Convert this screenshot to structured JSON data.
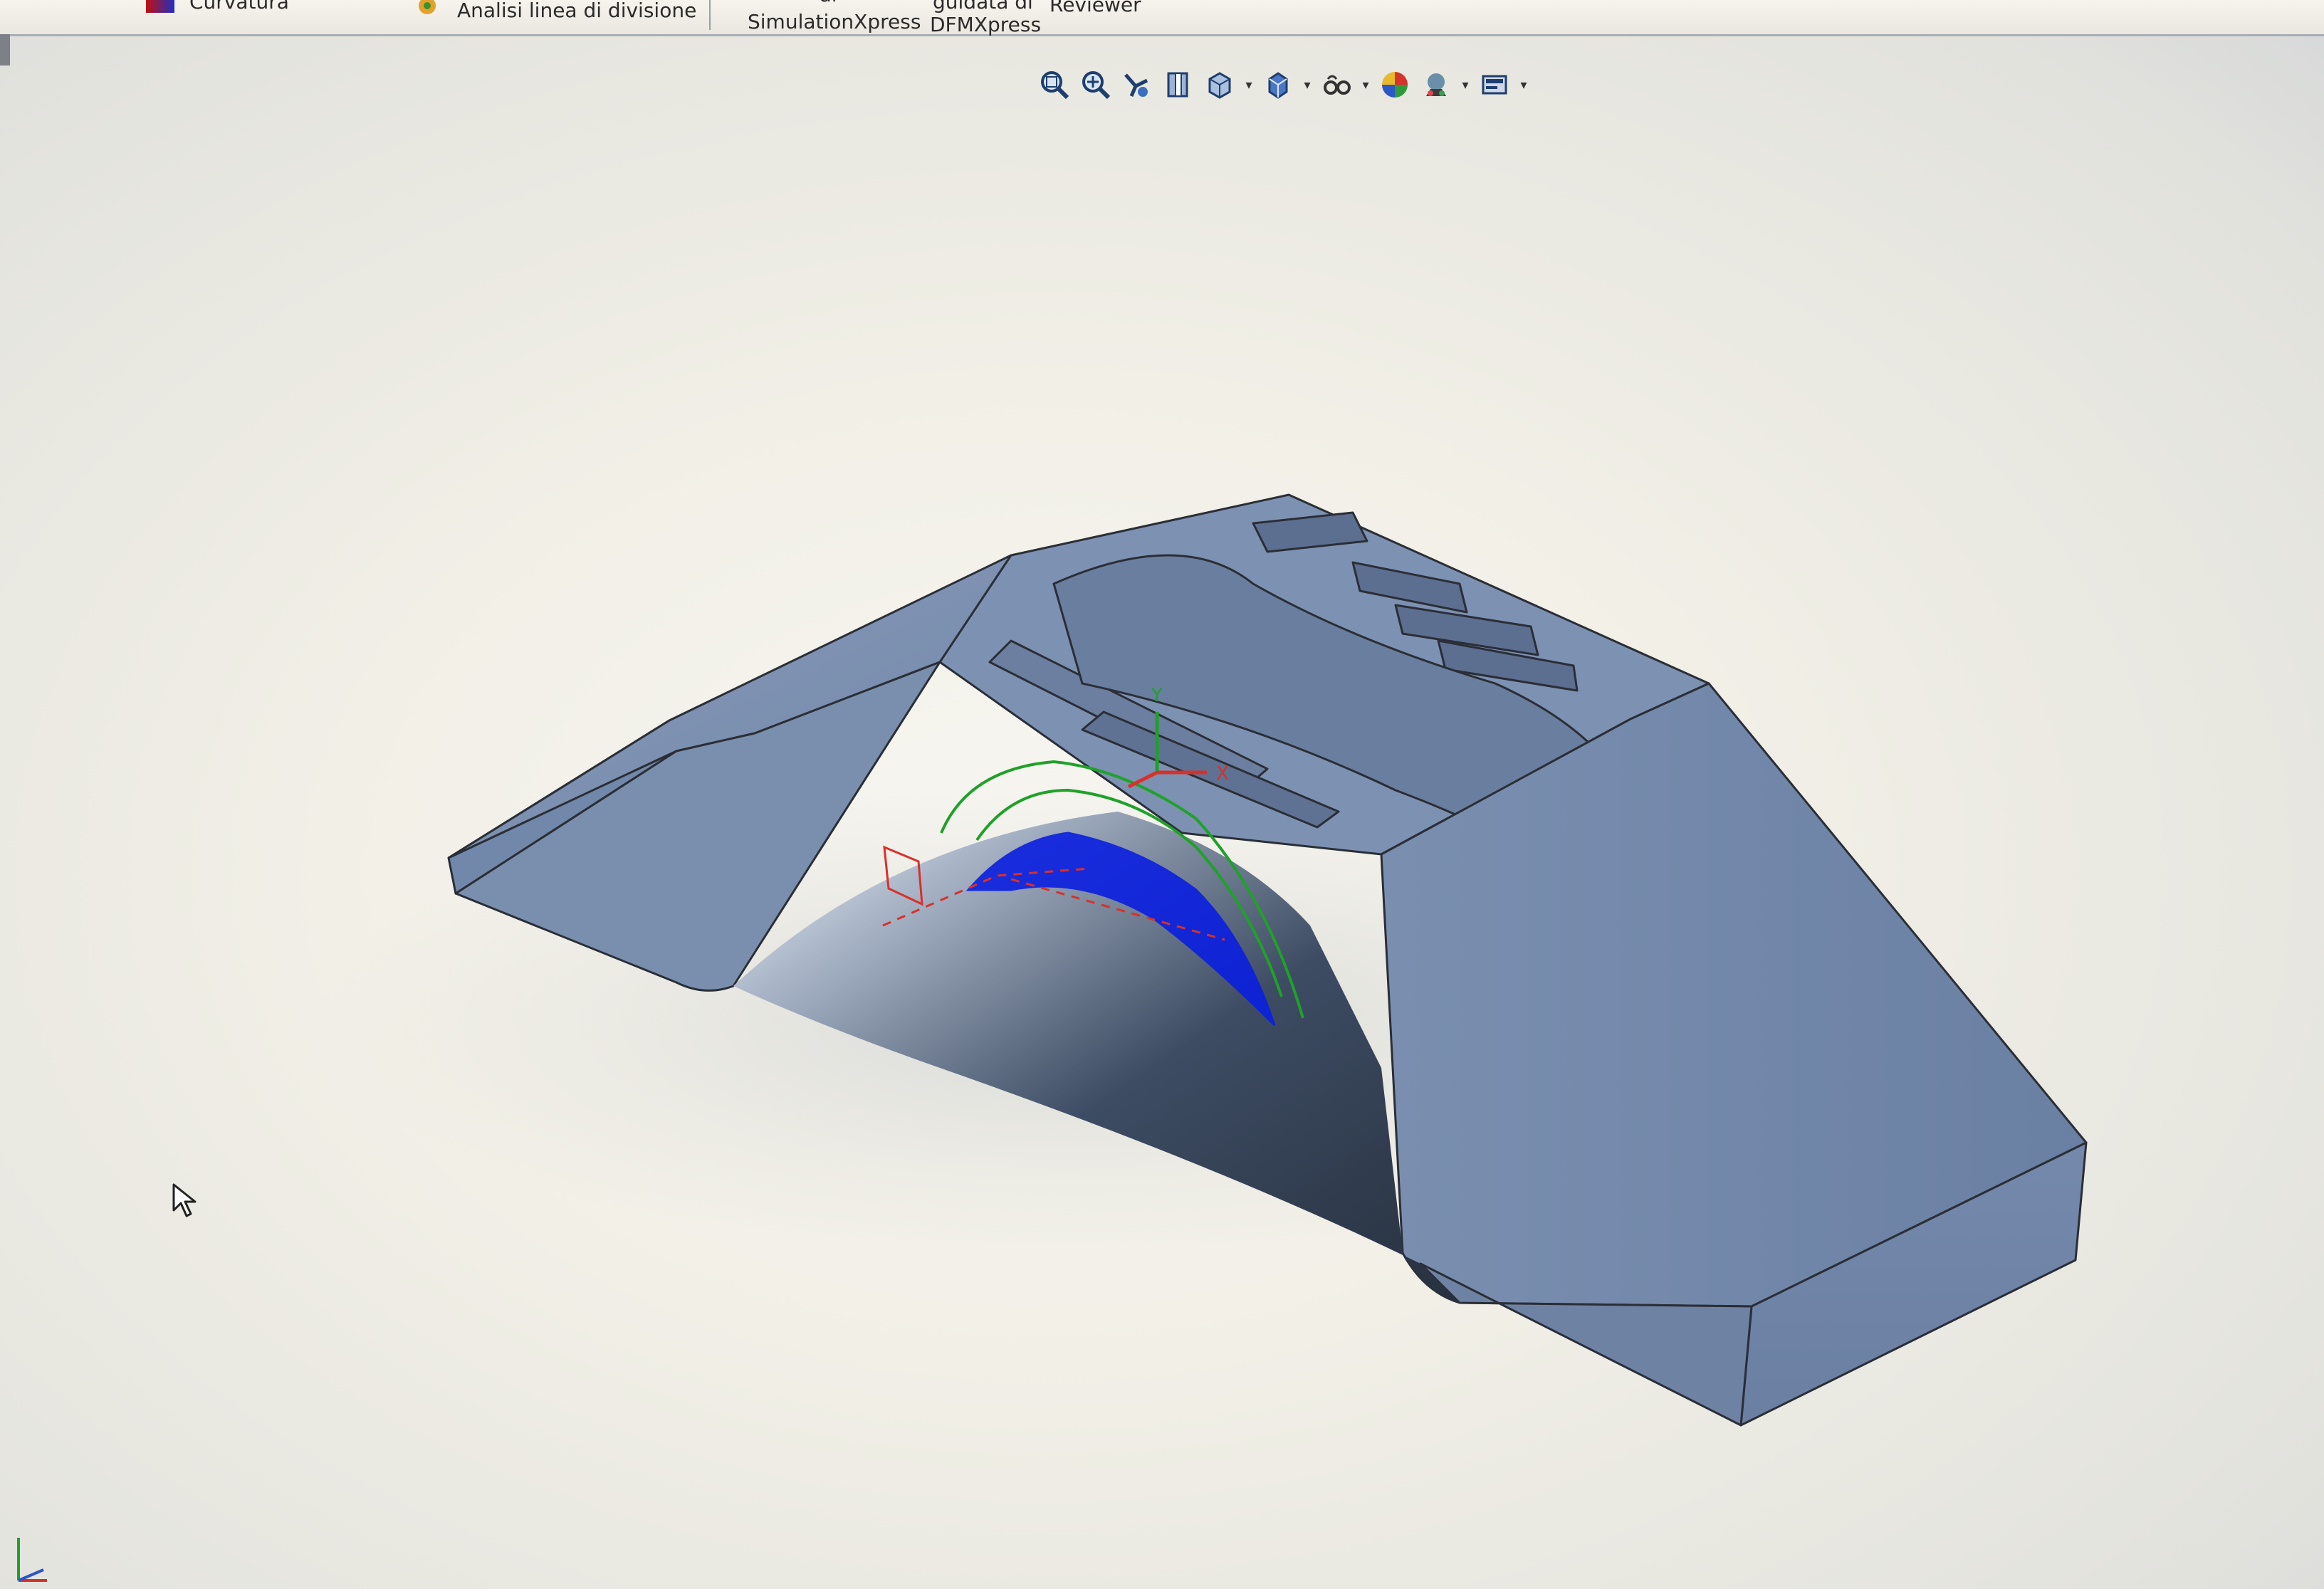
{
  "ribbon": {
    "curvature_label": "Curvatura",
    "parting_line_label": "Analisi linea di divisione",
    "simulation_line1": "di",
    "simulation_line2": "SimulationXpress",
    "dfm_line1": "guidata di",
    "dfm_line2": "DFMXpress",
    "reviewer_label": "Reviewer"
  },
  "heads_up_toolbar": {
    "icons": [
      "zoom-to-fit-icon",
      "zoom-to-area-icon",
      "previous-view-icon",
      "section-view-icon",
      "view-orientation-icon",
      "display-style-icon",
      "hide-show-items-icon",
      "edit-appearance-icon",
      "apply-scene-icon",
      "view-settings-icon"
    ]
  },
  "model": {
    "body_color": "#6e83a4",
    "triad_labels": {
      "y": "Y",
      "x": "X"
    }
  },
  "colors": {
    "accent_green": "#1fa12a",
    "accent_blue": "#0a1fe0",
    "accent_red": "#d8302a"
  }
}
